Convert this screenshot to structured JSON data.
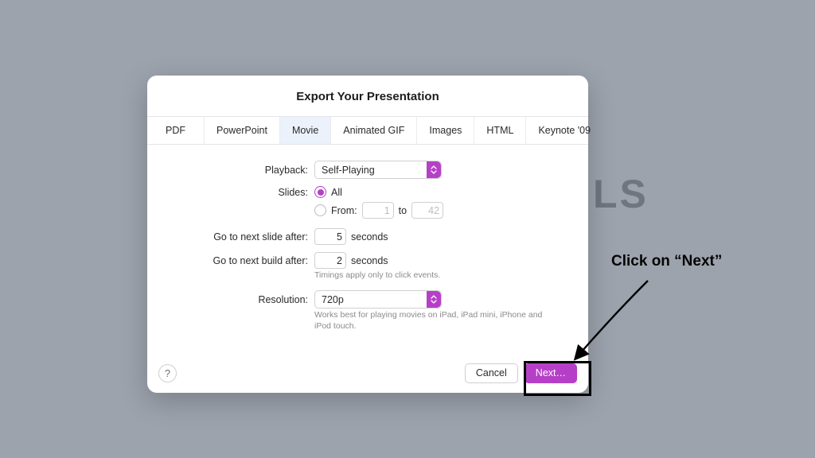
{
  "background_text": "LS",
  "dialog": {
    "title": "Export Your Presentation",
    "tabs": [
      "PDF",
      "PowerPoint",
      "Movie",
      "Animated GIF",
      "Images",
      "HTML",
      "Keynote '09"
    ],
    "active_tab": "Movie",
    "playback": {
      "label": "Playback:",
      "value": "Self-Playing"
    },
    "slides": {
      "label": "Slides:",
      "all_label": "All",
      "from_label": "From:",
      "to_label": "to",
      "from_value": "1",
      "to_value": "42"
    },
    "next_slide": {
      "label": "Go to next slide after:",
      "value": "5",
      "unit": "seconds"
    },
    "next_build": {
      "label": "Go to next build after:",
      "value": "2",
      "unit": "seconds"
    },
    "timings_hint": "Timings apply only to click events.",
    "resolution": {
      "label": "Resolution:",
      "value": "720p",
      "hint": "Works best for playing movies on iPad, iPad mini, iPhone and iPod touch."
    },
    "help_label": "?",
    "cancel_label": "Cancel",
    "next_label": "Next…"
  },
  "annotation": {
    "text": "Click on “Next”"
  }
}
